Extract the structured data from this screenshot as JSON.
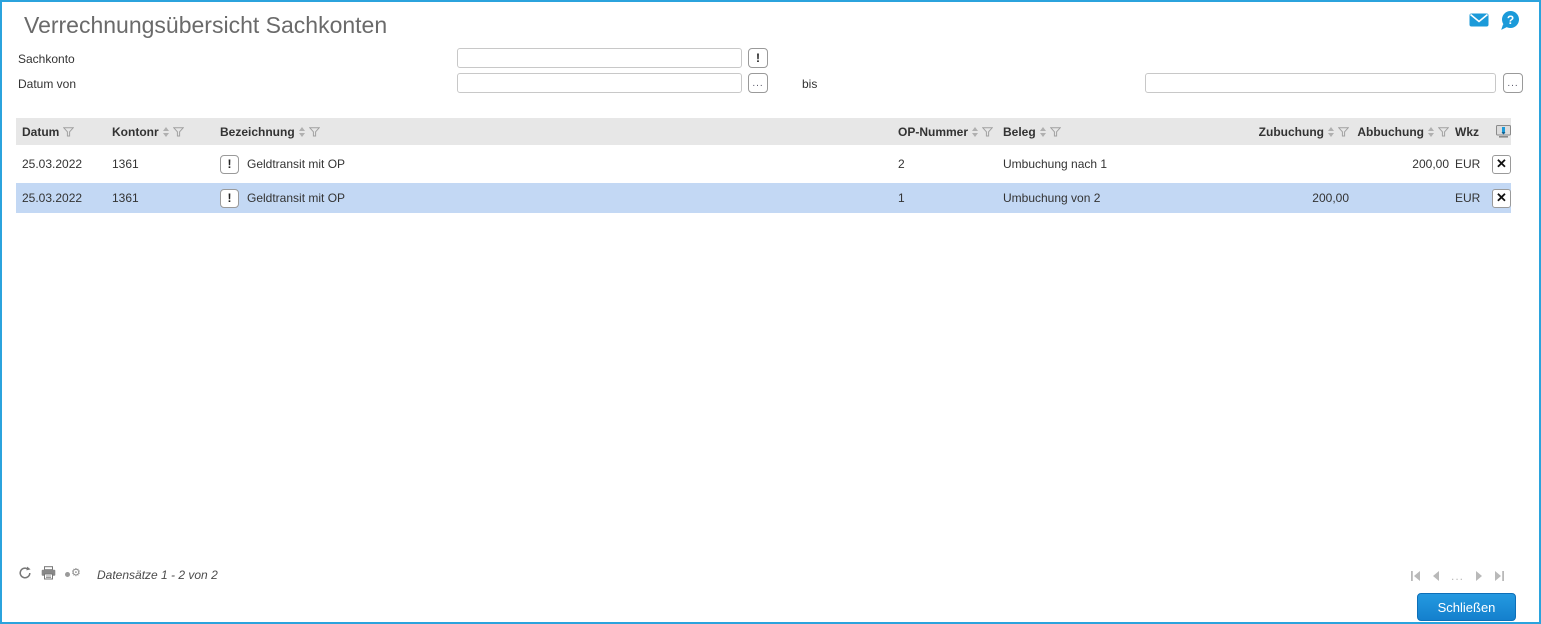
{
  "page": {
    "title": "Verrechnungsübersicht Sachkonten"
  },
  "filters": {
    "sachkonto_label": "Sachkonto",
    "sachkonto_value": "",
    "datum_von_label": "Datum von",
    "datum_von_value": "",
    "bis_label": "bis",
    "datum_bis_value": ""
  },
  "icons": {
    "exclamation": "!",
    "browse": "...",
    "close": "✕",
    "gear": "⚙",
    "pagination_ellipsis": "..."
  },
  "table": {
    "headers": {
      "datum": "Datum",
      "kontonr": "Kontonr",
      "bezeichnung": "Bezeichnung",
      "op_nummer": "OP-Nummer",
      "beleg": "Beleg",
      "zubuchung": "Zubuchung",
      "abbuchung": "Abbuchung",
      "wkz": "Wkz"
    },
    "rows": [
      {
        "datum": "25.03.2022",
        "kontonr": "1361",
        "flag": "!",
        "bezeichnung": "Geldtransit mit OP",
        "op_nummer": "2",
        "beleg": "Umbuchung nach 1",
        "zubuchung": "",
        "abbuchung": "200,00",
        "wkz": "EUR"
      },
      {
        "datum": "25.03.2022",
        "kontonr": "1361",
        "flag": "!",
        "bezeichnung": "Geldtransit mit OP",
        "op_nummer": "1",
        "beleg": "Umbuchung von 2",
        "zubuchung": "200,00",
        "abbuchung": "",
        "wkz": "EUR"
      }
    ],
    "selected_row_index": 1
  },
  "footer": {
    "record_info": "Datensätze 1 - 2 von 2",
    "close_button": "Schließen"
  },
  "colors": {
    "accent_blue": "#1b9ad9",
    "window_border": "#2ba3dd",
    "selected_row": "#c3d8f4",
    "header_bg": "#e7e7e7"
  }
}
